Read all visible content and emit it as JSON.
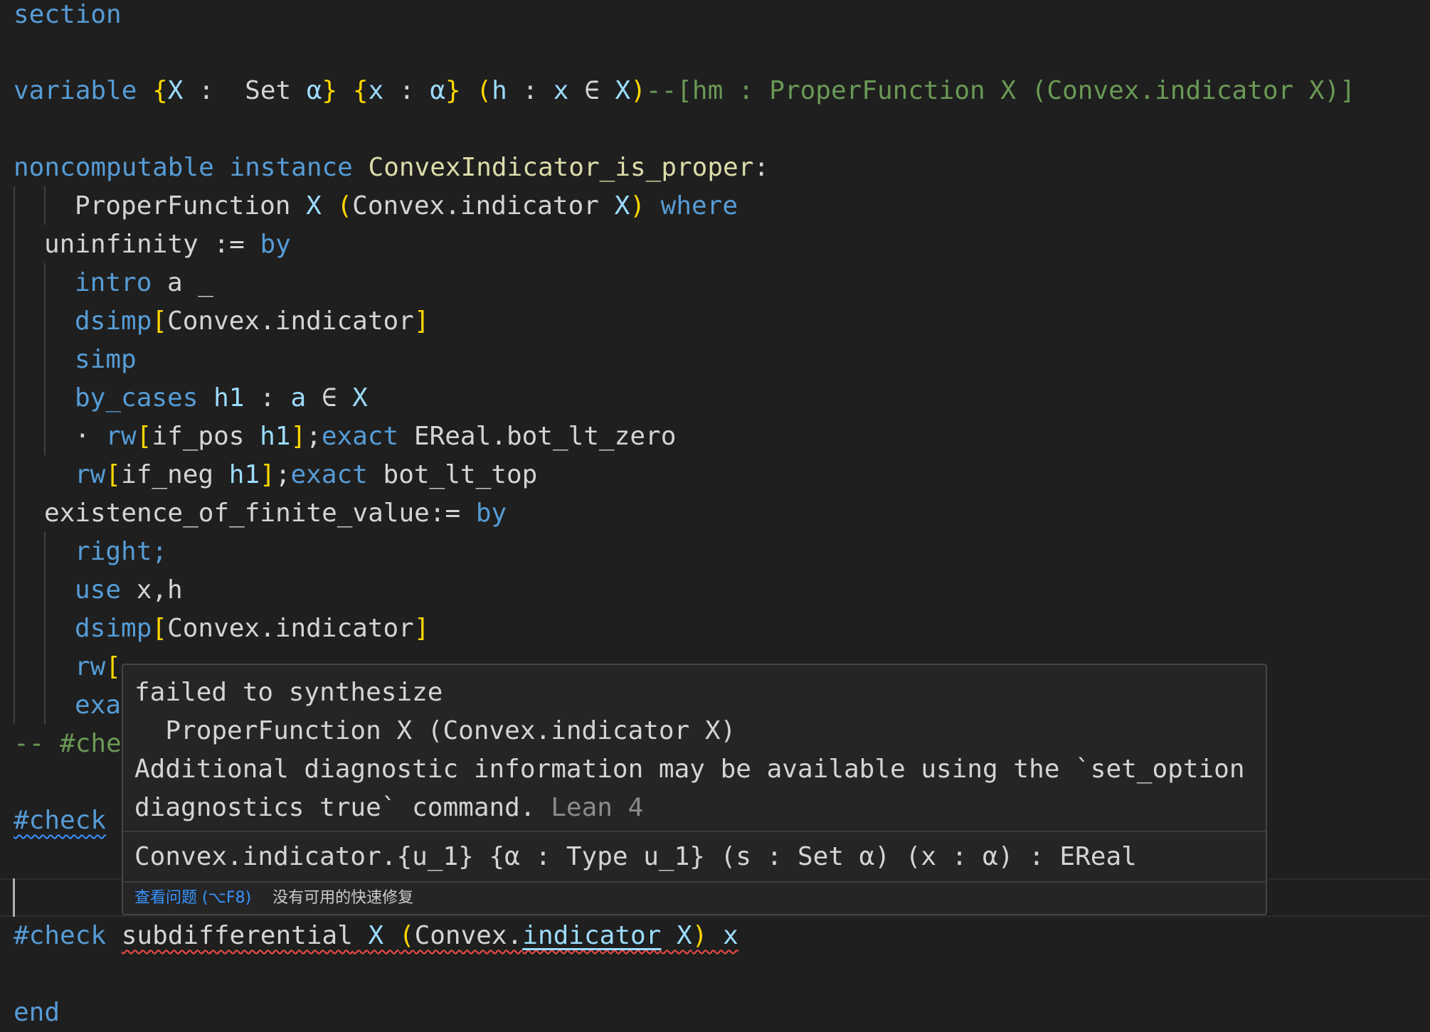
{
  "code": {
    "l1": "section",
    "l2": {
      "kw": "variable",
      "b1": "{",
      "x1": "X",
      "sep1": " :  ",
      "set": "Set",
      "alpha1": " α",
      "b2": "}",
      "sp1": " ",
      "b3": "{",
      "x2": "x",
      "sep2": " : ",
      "alpha2": "α",
      "b4": "}",
      "sp2": " ",
      "b5": "(",
      "h": "h",
      "sep3": " : ",
      "x3": "x",
      "mem": " ∈ ",
      "x4": "X",
      "b6": ")",
      "comment": "--[hm : ProperFunction X (Convex.indicator X)]"
    },
    "l3": {
      "kw1": "noncomputable",
      "kw2": "instance",
      "name": "ConvexIndicator_is_proper",
      "colon": ":"
    },
    "l4": {
      "t1": "ProperFunction",
      "x": " X ",
      "b1": "(",
      "t2": "Convex.indicator",
      "x2": " X",
      "b2": ")",
      "kw": " where"
    },
    "l5": {
      "t": "uninfinity := ",
      "kw": "by"
    },
    "l6": {
      "kw": "intro",
      "rest": " a _"
    },
    "l7": {
      "kw": "dsimp",
      "b1": "[",
      "t": "Convex.indicator",
      "b2": "]"
    },
    "l8": "simp",
    "l9": {
      "kw": "by_cases",
      "h": " h1",
      "t": " : ",
      "a": "a",
      "mem": " ∈ ",
      "x": "X"
    },
    "l10": {
      "dot": "· ",
      "kw": "rw",
      "b1": "[",
      "t": "if_pos",
      "h": " h1",
      "b2": "]",
      "semi": ";",
      "kw2": "exact",
      "rest": " EReal.bot_lt_zero"
    },
    "l11": {
      "kw": "rw",
      "b1": "[",
      "t": "if_neg",
      "h": " h1",
      "b2": "]",
      "semi": ";",
      "kw2": "exact",
      "rest": " bot_lt_top"
    },
    "l12": {
      "t": "existence_of_finite_value:= ",
      "kw": "by"
    },
    "l13": "right;",
    "l14": {
      "kw": "use",
      "rest": " x,h"
    },
    "l15": {
      "kw": "dsimp",
      "b1": "[",
      "t": "Convex.indicator",
      "b2": "]"
    },
    "l16": {
      "kw": "rw",
      "b1": "["
    },
    "l17": "exa",
    "l18": "-- #che",
    "l19": "#check",
    "l20": {
      "kw": "#check",
      "t1": "subdifferential",
      "x": " X ",
      "b1": "(",
      "t2": "Convex.",
      "t3": "indicator",
      "x2": " X",
      "b2": ")",
      "x3": " x"
    },
    "l21": "end"
  },
  "hover": {
    "msg_l1": "failed to synthesize",
    "msg_l2": "  ProperFunction X (Convex.indicator X)",
    "msg_l3": "Additional diagnostic information may be available using the `set_option",
    "msg_l4": "diagnostics true` command.",
    "source": "Lean 4",
    "signature": "Convex.indicator.{u_1} {α : Type u_1} (s : Set α) (x : α) : EReal",
    "view_problem": "查看问题 (⌥F8)",
    "no_quick_fix": "没有可用的快速修复"
  }
}
